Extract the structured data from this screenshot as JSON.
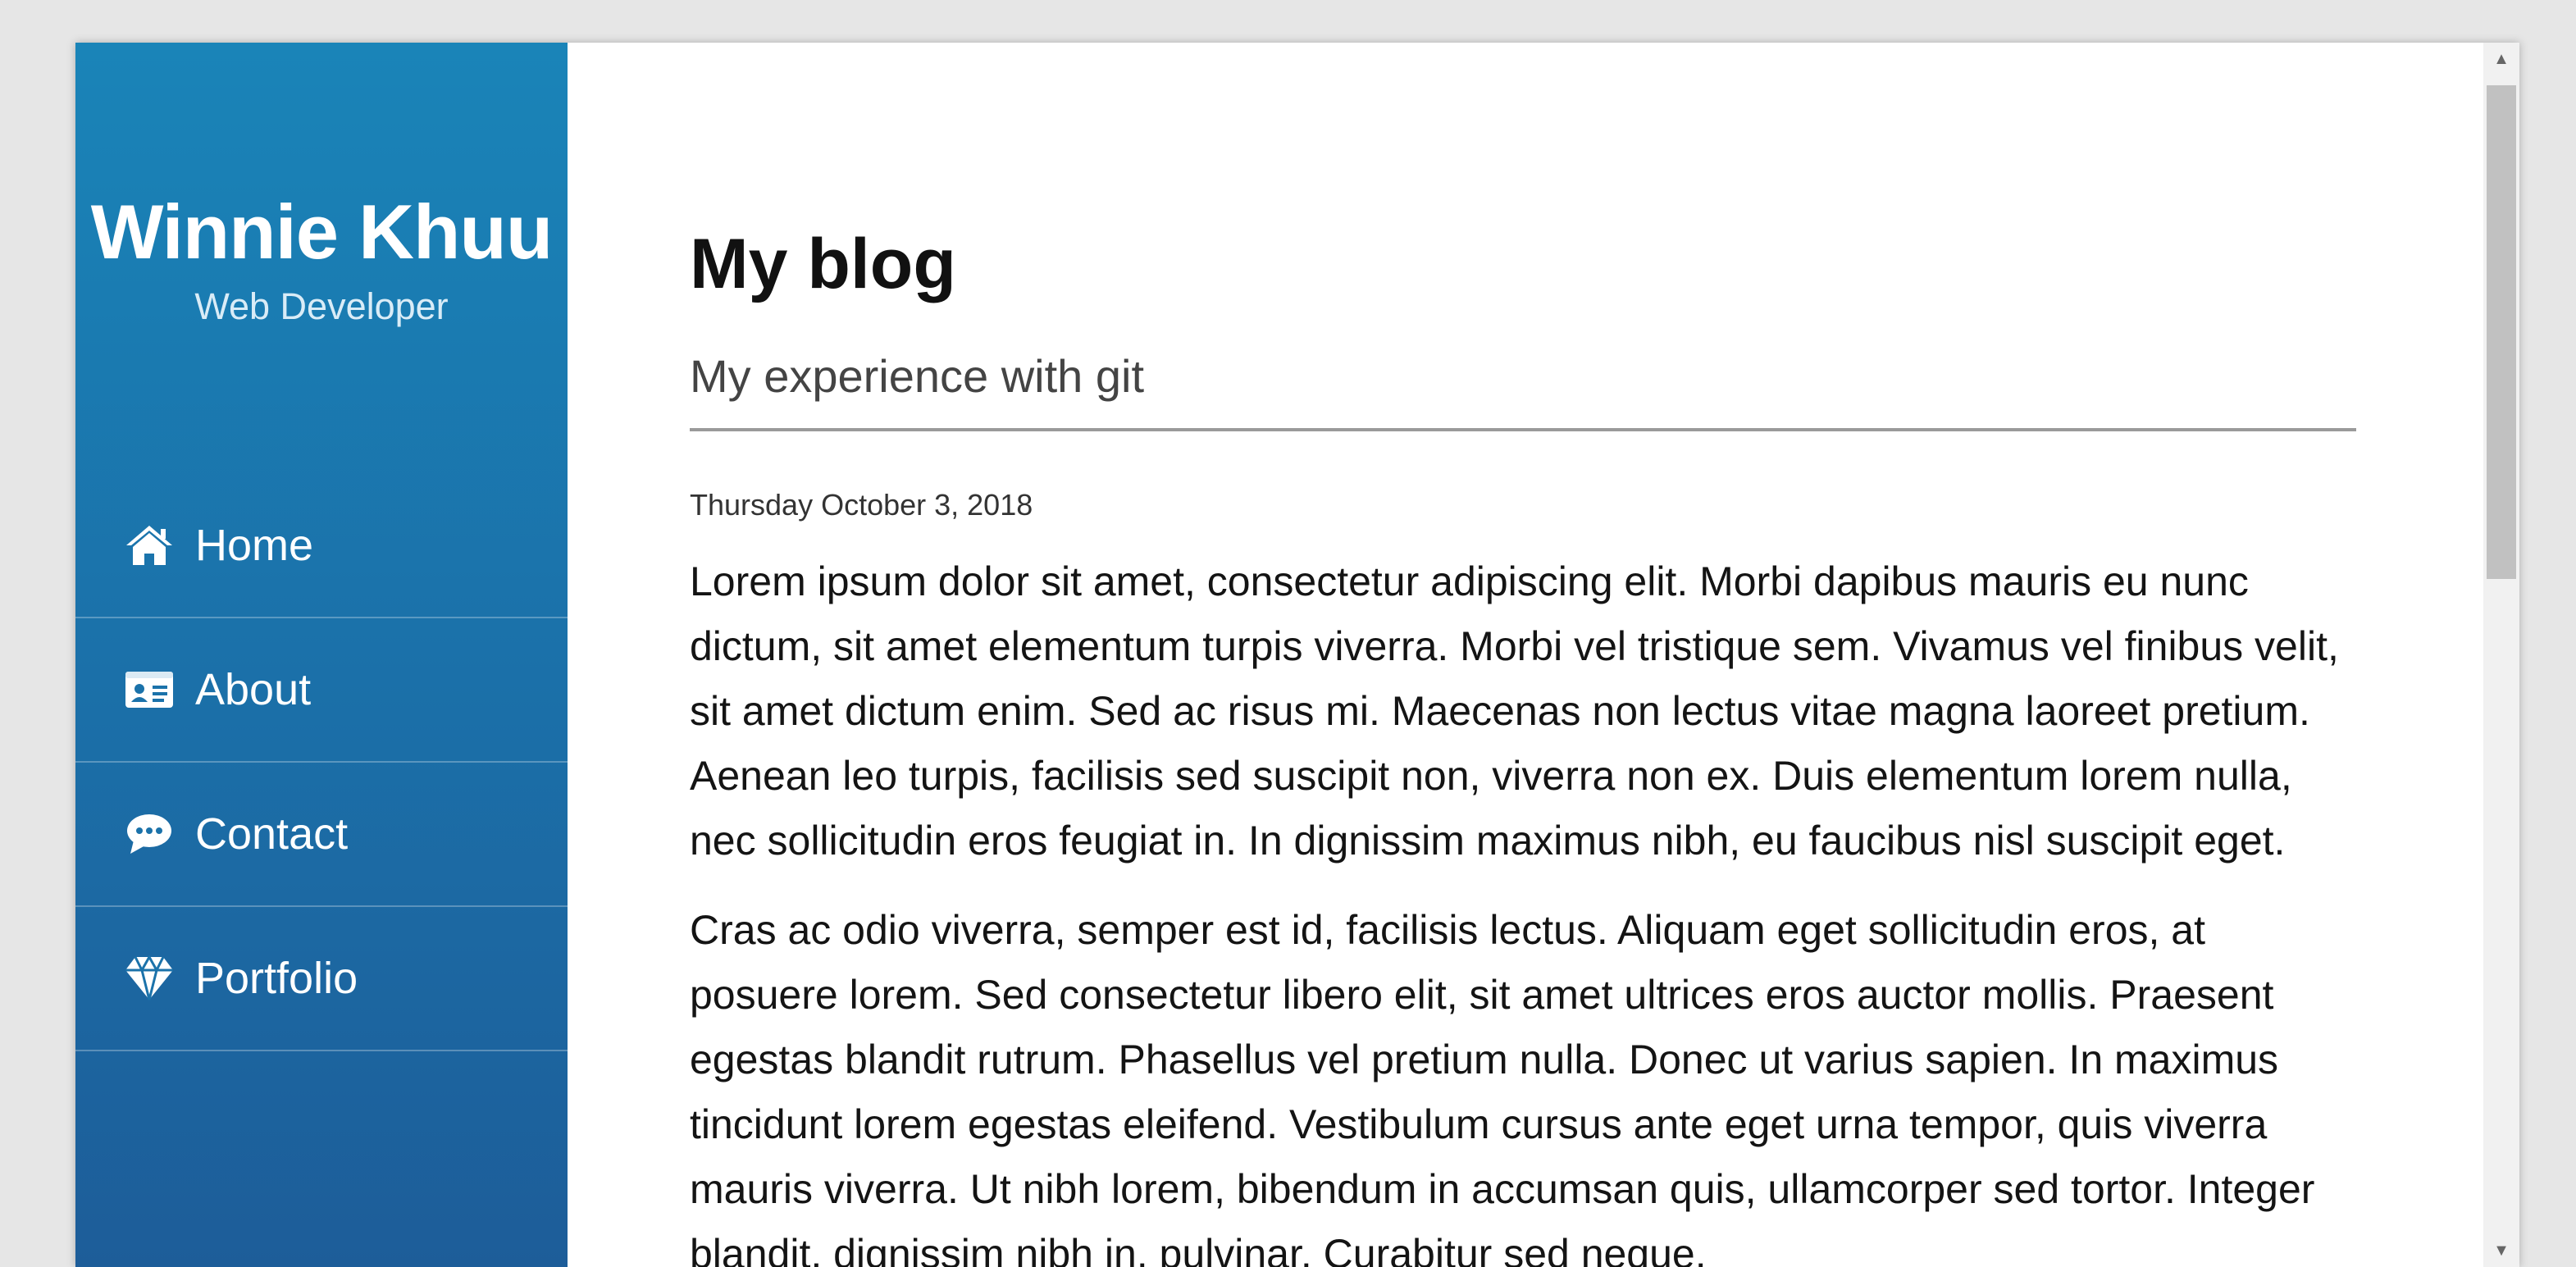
{
  "sidebar": {
    "brand_name": "Winnie Khuu",
    "brand_role": "Web Developer",
    "items": [
      {
        "label": "Home",
        "icon": "home-icon"
      },
      {
        "label": "About",
        "icon": "id-card-icon"
      },
      {
        "label": "Contact",
        "icon": "chat-bubble-icon"
      },
      {
        "label": "Portfolio",
        "icon": "diamond-icon"
      }
    ]
  },
  "main": {
    "page_title": "My blog",
    "post": {
      "title": "My experience with git",
      "date": "Thursday October 3, 2018",
      "paragraphs": [
        "Lorem ipsum dolor sit amet, consectetur adipiscing elit. Morbi dapibus mauris eu nunc dictum, sit amet elementum turpis viverra. Morbi vel tristique sem. Vivamus vel finibus velit, sit amet dictum enim. Sed ac risus mi. Maecenas non lectus vitae magna laoreet pretium. Aenean leo turpis, facilisis sed suscipit non, viverra non ex. Duis elementum lorem nulla, nec sollicitudin eros feugiat in. In dignissim maximus nibh, eu faucibus nisl suscipit eget.",
        "Cras ac odio viverra, semper est id, facilisis lectus. Aliquam eget sollicitudin eros, at posuere lorem. Sed consectetur libero elit, sit amet ultrices eros auctor mollis. Praesent egestas blandit rutrum. Phasellus vel pretium nulla. Donec ut varius sapien. In maximus tincidunt lorem egestas eleifend. Vestibulum cursus ante eget urna tempor, quis viverra mauris viverra. Ut nibh lorem, bibendum in accumsan quis, ullamcorper sed tortor. Integer blandit, dignissim nibh in, pulvinar. Curabitur sed neque."
      ]
    }
  },
  "colors": {
    "sidebar_top": "#1a84b8",
    "sidebar_bottom": "#1d5d99",
    "text_dark": "#111111"
  }
}
